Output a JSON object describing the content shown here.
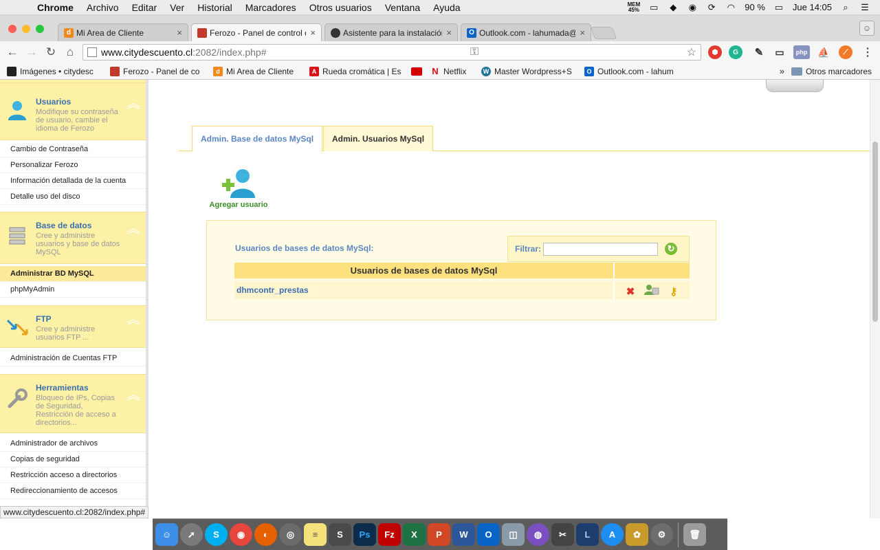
{
  "menubar": {
    "app": "Chrome",
    "items": [
      "Archivo",
      "Editar",
      "Ver",
      "Historial",
      "Marcadores",
      "Otros usuarios",
      "Ventana",
      "Ayuda"
    ],
    "mem_label": "MEM",
    "mem_value": "45%",
    "battery": "90 %",
    "clock": "Jue 14:05"
  },
  "tabs": [
    {
      "label": "Mi Area de Cliente",
      "icon": "d-logo-icon",
      "color": "#f08a1c"
    },
    {
      "label": "Ferozo - Panel de control d",
      "icon": "ferozo-icon",
      "color": "#c0392b"
    },
    {
      "label": "Asistente para la instalación",
      "icon": "github-icon",
      "color": "#333333"
    },
    {
      "label": "Outlook.com - lahumada@",
      "icon": "outlook-icon",
      "color": "#0a64c8"
    }
  ],
  "toolbar": {
    "url_host": "www.citydescuento.cl",
    "url_path": ":2082/index.php#"
  },
  "bookmarks": [
    {
      "label": "Imágenes • citydesc",
      "icon": "bookmark-images-icon",
      "color": "#222222"
    },
    {
      "label": "Ferozo - Panel de co",
      "icon": "ferozo-icon",
      "color": "#c0392b"
    },
    {
      "label": "Mi Area de Cliente",
      "icon": "d-logo-icon",
      "color": "#f08a1c"
    },
    {
      "label": "Rueda cromática | Es",
      "icon": "adobe-icon",
      "color": "#d7141a"
    },
    {
      "label": "",
      "icon": "red-badge-icon",
      "color": "#d40000"
    },
    {
      "label": "Netflix",
      "icon": "netflix-icon",
      "color": "#e50914"
    },
    {
      "label": "Master Wordpress+S",
      "icon": "wordpress-icon",
      "color": "#21759b"
    },
    {
      "label": "Outlook.com - lahum",
      "icon": "outlook-icon",
      "color": "#0a64c8"
    }
  ],
  "bookmarks_more": "»",
  "bookmarks_other": "Otros marcadores",
  "sidebar": {
    "sections": [
      {
        "title": "Usuarios",
        "desc": "Modifique su contraseña de usuario, cambie el idioma de Ferozo",
        "icon": "user-icon",
        "items": [
          "Cambio de Contraseña",
          "Personalizar Ferozo",
          "Información detallada de la cuenta",
          "Detalle uso del disco"
        ]
      },
      {
        "title": "Base de datos",
        "desc": "Cree y administre usuarios y base de datos MySQL",
        "icon": "database-icon",
        "items": [
          "Administrar BD MySQL",
          "phpMyAdmin"
        ]
      },
      {
        "title": "FTP",
        "desc": "Cree y administre usuarios FTP ...",
        "icon": "ftp-arrows-icon",
        "items": [
          "Administración de Cuentas FTP"
        ]
      },
      {
        "title": "Herramientas",
        "desc": "Bloqueo de IPs, Copias de Seguridad, Restricción de acceso a directorios...",
        "icon": "wrench-icon",
        "items": [
          "Administrador de archivos",
          "Copias de seguridad",
          "Restricción acceso a directorios",
          "Redireccionamiento de accesos"
        ]
      }
    ]
  },
  "content": {
    "tab1": "Admin. Base de datos MySql",
    "tab2": "Admin. Usuarios MySql",
    "add_user": "Agregar usuario",
    "panel_title": "Usuarios de bases de datos MySql:",
    "filter_label": "Filtrar:",
    "filter_value": "",
    "table_header": "Usuarios de bases de datos MySql",
    "rows": [
      {
        "name": "dhmcontr_prestas"
      }
    ]
  },
  "statusbar": "www.citydescuento.cl:2082/index.php#",
  "dock": [
    {
      "icon": "finder-icon",
      "color": "#3d8ee6"
    },
    {
      "icon": "launchpad-icon",
      "color": "#7a7a7a"
    },
    {
      "icon": "skype-icon",
      "color": "#00aff0"
    },
    {
      "icon": "chrome-icon",
      "color": "#e8453c"
    },
    {
      "icon": "firefox-icon",
      "color": "#e66000"
    },
    {
      "icon": "sequel-icon",
      "color": "#6b6b6b"
    },
    {
      "icon": "notes-icon",
      "color": "#f5e27a"
    },
    {
      "icon": "sublime-icon",
      "color": "#4a4a4a"
    },
    {
      "icon": "photoshop-icon",
      "color": "#0b2c4a"
    },
    {
      "icon": "filezilla-icon",
      "color": "#bf0000"
    },
    {
      "icon": "excel-icon",
      "color": "#1f7244"
    },
    {
      "icon": "powerpoint-icon",
      "color": "#d24726"
    },
    {
      "icon": "word-icon",
      "color": "#2b579a"
    },
    {
      "icon": "outlook-icon",
      "color": "#0a64c8"
    },
    {
      "icon": "preview-icon",
      "color": "#8a9aa8"
    },
    {
      "icon": "motion-icon",
      "color": "#7b4fbf"
    },
    {
      "icon": "final-cut-icon",
      "color": "#444444"
    },
    {
      "icon": "lightroom-icon",
      "color": "#1c3d6e"
    },
    {
      "icon": "app-store-icon",
      "color": "#1d8ef0"
    },
    {
      "icon": "pineapple-icon",
      "color": "#c79a2a"
    },
    {
      "icon": "system-preferences-icon",
      "color": "#6d6d6d"
    },
    {
      "icon": "trash-icon",
      "color": "#9c9c9c"
    }
  ]
}
